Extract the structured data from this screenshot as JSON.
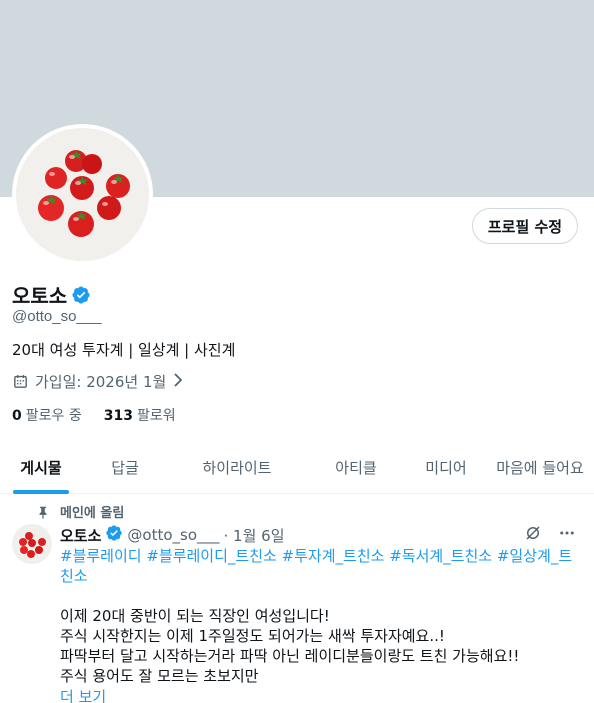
{
  "profile": {
    "display_name": "오토소",
    "handle": "@otto_so___",
    "bio": "20대 여성 투자계 | 일상계 | 사진계",
    "joined": "가입일: 2026년 1월",
    "following_count": "0",
    "following_label": "팔로우 중",
    "followers_count": "313",
    "followers_label": "팔로워",
    "edit_button": "프로필 수정"
  },
  "tabs": [
    {
      "label": "게시물",
      "active": true
    },
    {
      "label": "답글",
      "active": false
    },
    {
      "label": "하이라이트",
      "active": false
    },
    {
      "label": "아티클",
      "active": false
    },
    {
      "label": "미디어",
      "active": false
    },
    {
      "label": "마음에 들어요",
      "active": false
    }
  ],
  "pinned_post": {
    "pinned_label": "메인에 올림",
    "author_name": "오토소",
    "author_handle": "@otto_so___",
    "date": "· 1월 6일",
    "hashtags": "#블루레이디 #블루레이디_트친소 #투자계_트친소 #독서계_트친소 #일상계_트친소",
    "lines": [
      "이제 20대 중반이 되는 직장인 여성입니다!",
      "주식 시작한지는 이제 1주일정도 되어가는 새싹 투자자예요..!",
      "파딱부터 달고 시작하는거라 파딱 아닌 레이디분들이랑도 트친 가능해요!!",
      "주식 용어도 잘 모르는 초보지만"
    ],
    "show_more": "더 보기"
  },
  "colors": {
    "banner": "#cfd9de",
    "accent": "#1d9bf0",
    "secondary_text": "#536471"
  },
  "icons": [
    "verified-badge-icon",
    "calendar-icon",
    "chevron-right-icon",
    "pin-icon",
    "grok-icon",
    "more-icon"
  ]
}
